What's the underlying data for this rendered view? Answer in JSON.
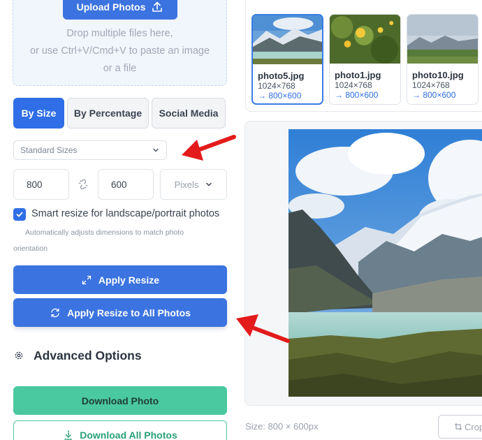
{
  "upload": {
    "button_label": "Upload Photos",
    "drop_line_1": "Drop multiple files here,",
    "drop_line_2": "or use Ctrl+V/Cmd+V to paste an image",
    "drop_line_3": "or a file"
  },
  "tabs": [
    {
      "label": "By Size",
      "active": true
    },
    {
      "label": "By Percentage",
      "active": false
    },
    {
      "label": "Social Media",
      "active": false
    }
  ],
  "preset_select": {
    "value": "Standard Sizes"
  },
  "dimensions": {
    "width": "800",
    "height": "600",
    "unit": "Pixels"
  },
  "smart_resize": {
    "checked": true,
    "label": "Smart resize for landscape/portrait photos",
    "hint_line_1": "Automatically adjusts dimensions to match photo",
    "hint_line_2": "orientation"
  },
  "actions": {
    "apply_resize": "Apply Resize",
    "apply_all": "Apply Resize to All Photos",
    "advanced_options": "Advanced Options",
    "download_photo": "Download Photo",
    "download_all": "Download All Photos"
  },
  "thumbnails": [
    {
      "name": "photo5.jpg",
      "original": "1024×768",
      "target": "→ 800×600",
      "selected": true
    },
    {
      "name": "photo1.jpg",
      "original": "1024×768",
      "target": "→ 800×600",
      "selected": false
    },
    {
      "name": "photo10.jpg",
      "original": "1024×768",
      "target": "→ 800×600",
      "selected": false
    }
  ],
  "preview": {
    "size_info": "Size: 800 × 600px",
    "crop_label": "Crop"
  },
  "colors": {
    "primary": "#3b73e0",
    "success": "#4ac9a0",
    "annotation_arrow": "#e31b1b"
  }
}
